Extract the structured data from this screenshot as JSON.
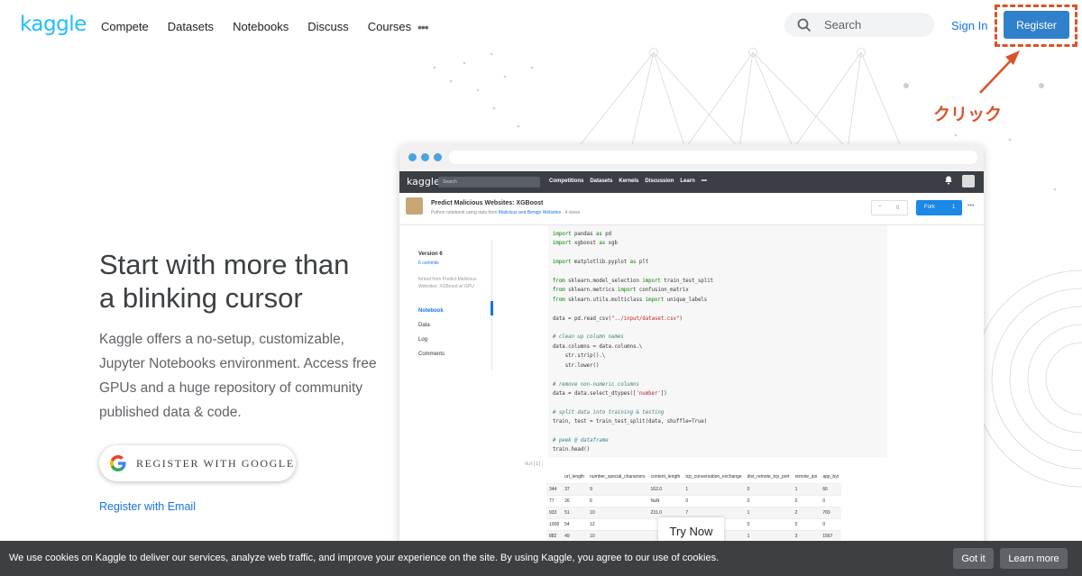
{
  "nav": {
    "logo": "kaggle",
    "links": [
      "Compete",
      "Datasets",
      "Notebooks",
      "Discuss",
      "Courses"
    ],
    "more": "•••",
    "search_placeholder": "Search",
    "signin": "Sign In",
    "register": "Register"
  },
  "annotation": {
    "click_label": "クリック",
    "color": "#d9532a"
  },
  "hero": {
    "headline_line1": "Start with more than",
    "headline_line2": "a blinking cursor",
    "description": "Kaggle offers a no-setup, customizable, Jupyter Notebooks environment. Access free GPUs and a huge repository of community published data & code.",
    "google_button": "REGISTER WITH GOOGLE",
    "email_link": "Register with Email"
  },
  "mock": {
    "logo": "kaggle",
    "search": "Search",
    "nav": [
      "Competitions",
      "Datasets",
      "Kernels",
      "Discussion",
      "Learn",
      "•••"
    ],
    "title": "Predict Malicious Websites: XGBoost",
    "subtitle_prefix": "Python notebook using data from",
    "subtitle_link": "Malicious and Benign Websites",
    "subtitle_suffix": "· 4 views",
    "vote_count": "0",
    "fork_label": "Fork",
    "fork_count": "1",
    "version": "Version 6",
    "commits": "6 commits",
    "forked_from": "forked from Predict Malicious Websites: XGBoost w/ GPU",
    "side_items": [
      "Notebook",
      "Data",
      "Log",
      "Comments"
    ],
    "code_lines": [
      {
        "t": "kw",
        "v": "import"
      },
      {
        "t": "plain",
        "v": ""
      }
    ],
    "output_label": "Out[1]:",
    "table_headers": [
      "",
      "url_length",
      "number_special_characters",
      "content_length",
      "tcp_conversation_exchange",
      "dist_remote_tcp_port",
      "remote_ips",
      "app_byt"
    ],
    "table_rows": [
      [
        "344",
        "37",
        "9",
        "162.0",
        "1",
        "0",
        "1",
        "66"
      ],
      [
        "77",
        "26",
        "6",
        "NaN",
        "0",
        "0",
        "0",
        "0"
      ],
      [
        "933",
        "51",
        "10",
        "231.0",
        "7",
        "1",
        "2",
        "769"
      ],
      [
        "1008",
        "54",
        "12",
        "",
        "",
        "0",
        "0",
        "0"
      ],
      [
        "882",
        "49",
        "10",
        "",
        "",
        "1",
        "3",
        "1567"
      ]
    ],
    "try_now": "Try Now"
  },
  "cookie": {
    "text": "We use cookies on Kaggle to deliver our services, analyze web traffic, and improve your experience on the site. By using Kaggle, you agree to our use of cookies.",
    "got_it": "Got it",
    "learn_more": "Learn more"
  },
  "colors": {
    "brand": "#20beff",
    "link": "#1a73e8",
    "register_bg": "#3180cc",
    "cookie_bg": "#3c4043"
  }
}
